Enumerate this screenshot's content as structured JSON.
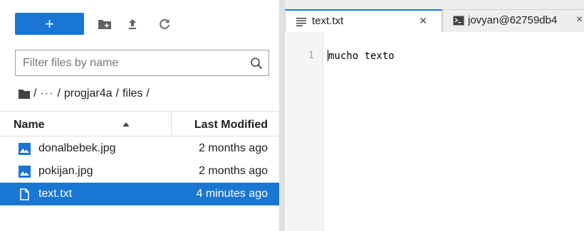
{
  "toolbar": {
    "new_label": "+",
    "icons": [
      "new-folder-icon",
      "upload-icon",
      "refresh-icon"
    ]
  },
  "filter": {
    "placeholder": "Filter files by name",
    "value": ""
  },
  "breadcrumb": {
    "ellipsis": "···",
    "separator": "/",
    "segments": [
      "progjar4a",
      "files"
    ]
  },
  "file_list": {
    "headers": {
      "name": "Name",
      "modified": "Last Modified"
    },
    "rows": [
      {
        "name": "donalbebek.jpg",
        "modified": "2 months ago",
        "icon": "image-file-icon",
        "selected": false
      },
      {
        "name": "pokijan.jpg",
        "modified": "2 months ago",
        "icon": "image-file-icon",
        "selected": false
      },
      {
        "name": "text.txt",
        "modified": "4 minutes ago",
        "icon": "text-file-icon",
        "selected": true
      }
    ]
  },
  "tabs": [
    {
      "label": "text.txt",
      "icon": "text-editor-icon",
      "active": true,
      "close": "×"
    },
    {
      "label": "jovyan@62759db4",
      "icon": "terminal-icon",
      "active": false,
      "close": "×"
    }
  ],
  "editor": {
    "line_number": "1",
    "content": "mucho texto"
  },
  "colors": {
    "accent": "#1976d2",
    "selected_text": "#ffffff",
    "splitter": "#e0e0e0"
  }
}
